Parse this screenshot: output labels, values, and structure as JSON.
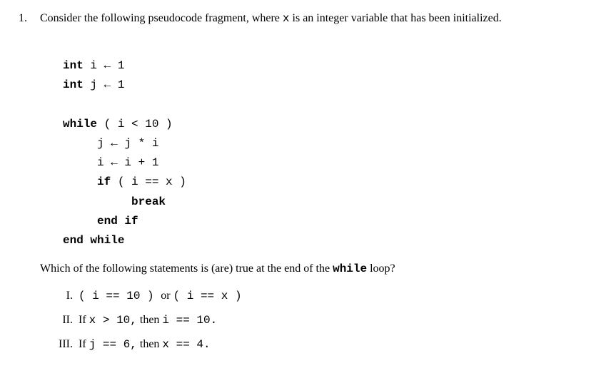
{
  "question": {
    "number": "1.",
    "prompt_prefix": "Consider the following pseudocode fragment, where ",
    "prompt_code": "x",
    "prompt_suffix": " is an integer variable that has been initialized."
  },
  "code": {
    "line1_kw": "int",
    "line1_rest": " i ← 1",
    "line2_kw": "int",
    "line2_rest": " j ← 1",
    "line3_kw": "while",
    "line3_rest": " ( i < 10 )",
    "line4": "j ← j * i",
    "line5": "i ← i + 1",
    "line6_kw": "if",
    "line6_rest": " ( i == x )",
    "line7_kw": "break",
    "line8_kw": "end if",
    "line9_kw": "end while"
  },
  "followup": {
    "prefix": "Which of the following statements is (are) true at the end of the ",
    "code": "while",
    "suffix": " loop?"
  },
  "options": {
    "I": {
      "label": "I.",
      "code": "( i == 10 ) ",
      "mid_text": "or ",
      "code2": "( i == x )"
    },
    "II": {
      "label": "II.",
      "prefix": "If ",
      "code": "x > 10,",
      "mid": " then ",
      "code2": "i == 10."
    },
    "III": {
      "label": "III.",
      "prefix": "If ",
      "code": "j == 6,",
      "mid": " then ",
      "code2": "x == 4."
    }
  }
}
